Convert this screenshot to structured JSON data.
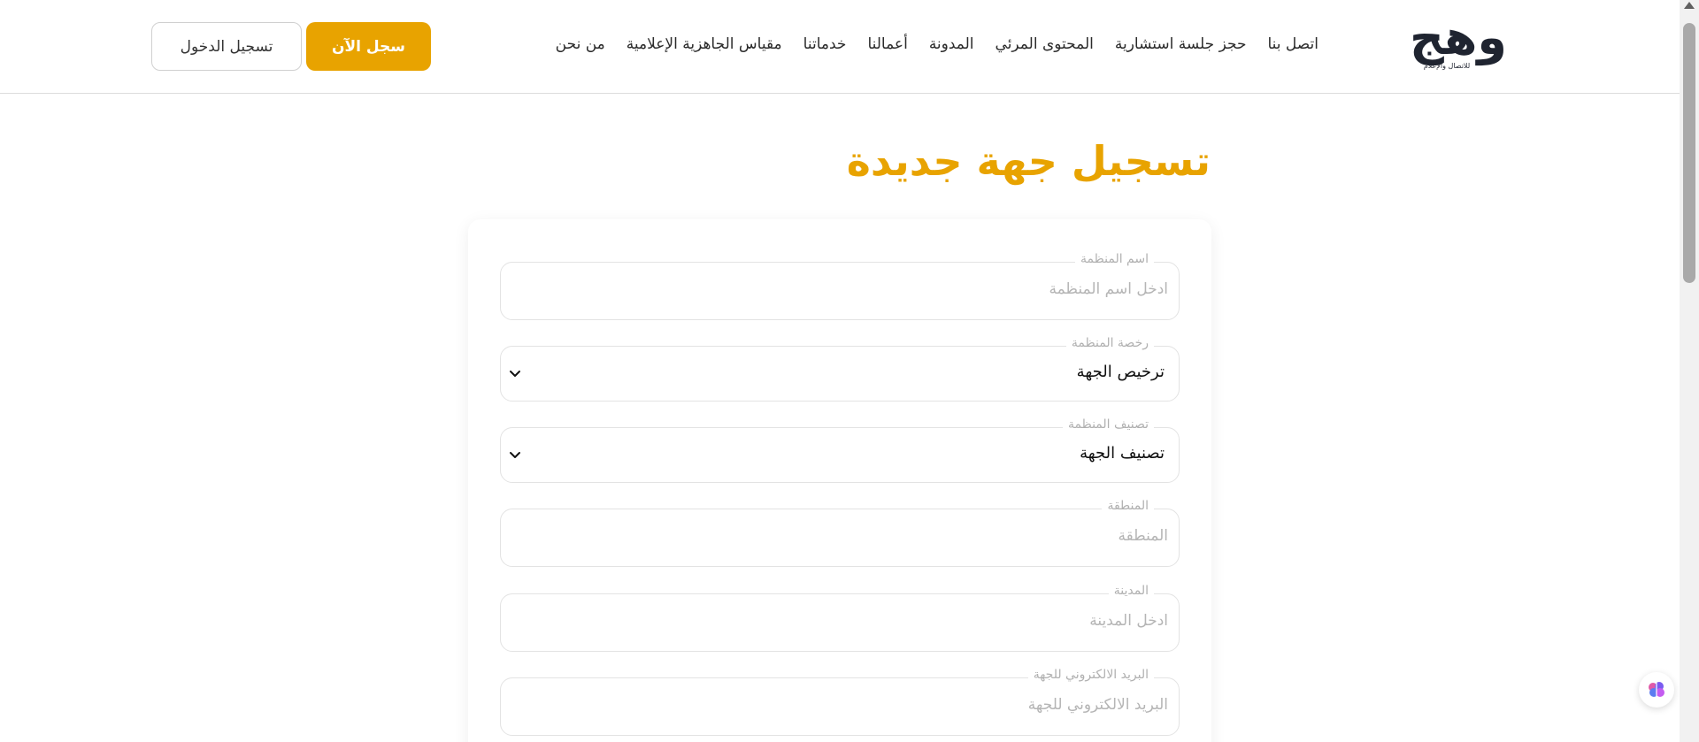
{
  "brand": {
    "logo_text": "وهج",
    "logo_tagline": "للاتصال والإعلام"
  },
  "nav": {
    "items": [
      {
        "label": "من نحن"
      },
      {
        "label": "مقياس الجاهزية الإعلامية"
      },
      {
        "label": "خدماتنا"
      },
      {
        "label": "أعمالنا"
      },
      {
        "label": "المدونة"
      },
      {
        "label": "المحتوى المرئي"
      },
      {
        "label": "حجز جلسة استشارية"
      },
      {
        "label": "اتصل بنا"
      }
    ]
  },
  "header_actions": {
    "register_label": "سجل الآن",
    "login_label": "تسجيل الدخول"
  },
  "page": {
    "title": "تسجيل جهة جديدة"
  },
  "form": {
    "org_name": {
      "label": "اسم المنظمة",
      "placeholder": "ادخل اسم المنظمة"
    },
    "org_license": {
      "label": "رخصة المنظمة",
      "value": "ترخيص الجهة"
    },
    "org_category": {
      "label": "تصنيف المنظمة",
      "value": "تصنيف الجهة"
    },
    "region": {
      "label": "المنطقة",
      "placeholder": "المنطقة"
    },
    "city": {
      "label": "المدينة",
      "placeholder": "ادخل المدينة"
    },
    "email": {
      "label": "البريد الالكتروني للجهة",
      "placeholder": "البريد الالكتروني للجهة"
    }
  },
  "colors": {
    "accent": "#e8a300",
    "text": "#2b2b2b",
    "border": "#e3e3e3"
  },
  "icons": {
    "chevron": "chevron-down-icon",
    "widget": "brain-icon"
  }
}
